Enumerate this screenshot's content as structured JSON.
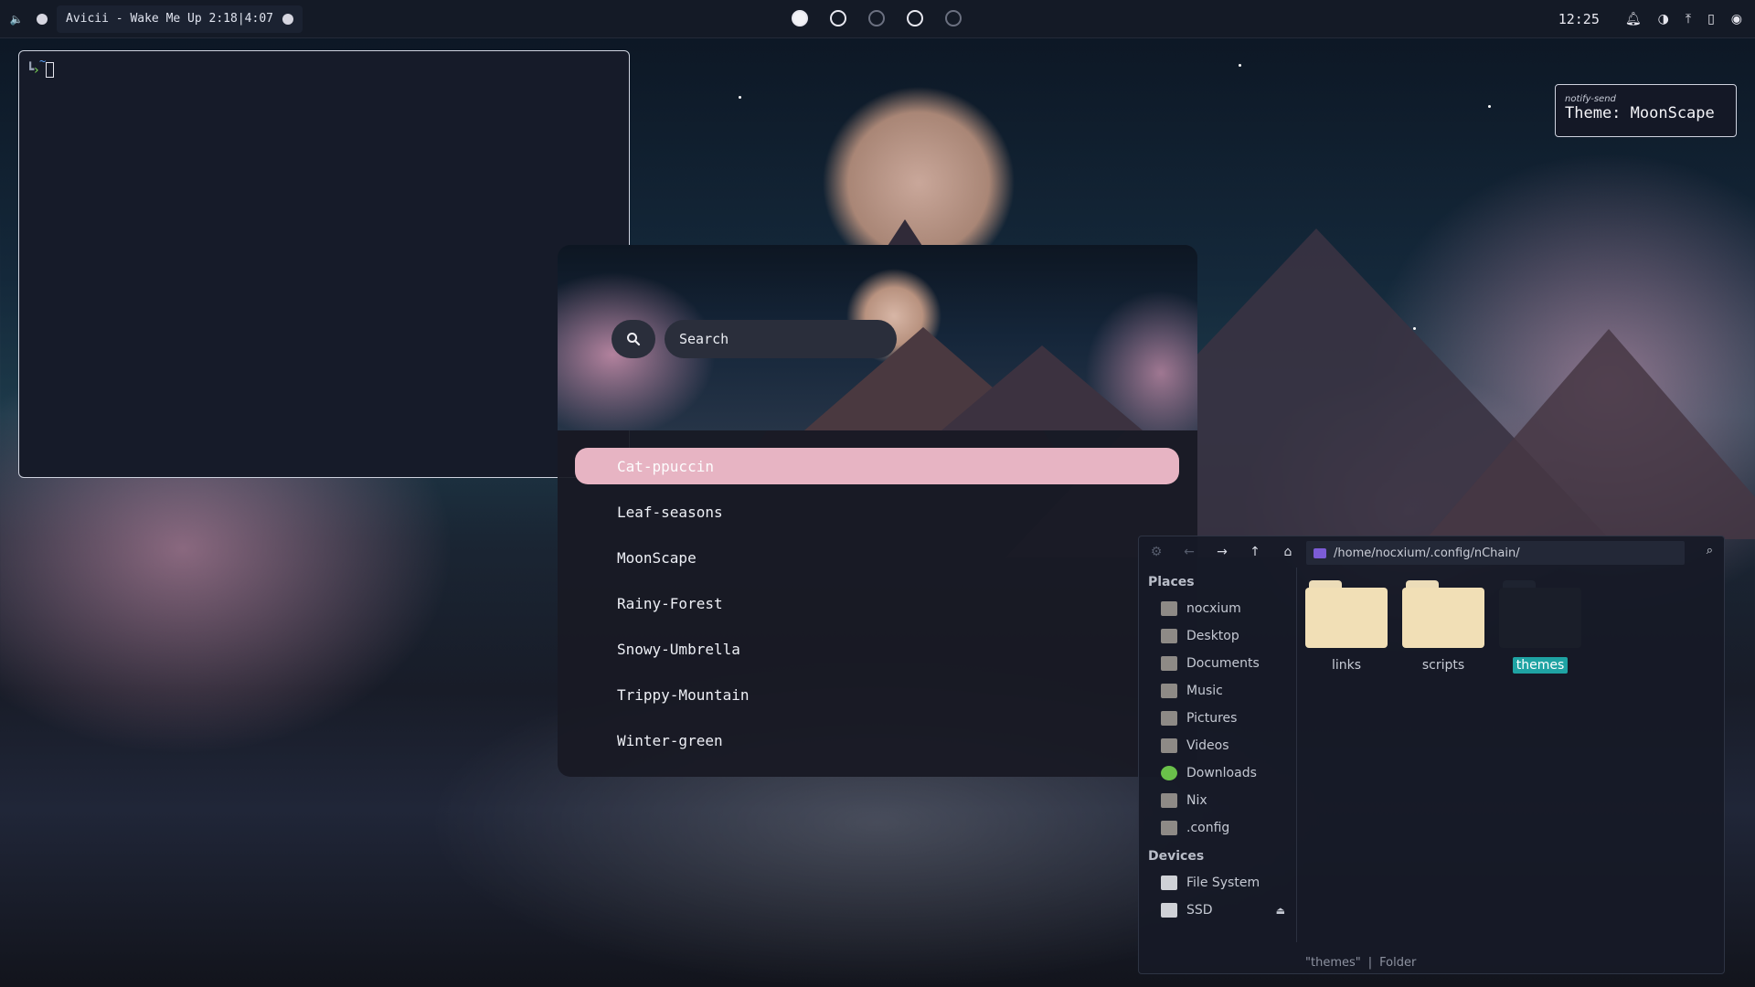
{
  "topbar": {
    "now_playing": "Avicii - Wake Me Up 2:18|4:07",
    "clock": "12:25",
    "workspaces": [
      {
        "state": "active"
      },
      {
        "state": "occupied"
      },
      {
        "state": "empty"
      },
      {
        "state": "occupied"
      },
      {
        "state": "empty"
      }
    ]
  },
  "terminal": {
    "prompt_dir": "~"
  },
  "notification": {
    "app": "notify-send",
    "message": "Theme: MoonScape"
  },
  "launcher": {
    "search_placeholder": "Search",
    "themes": [
      {
        "label": "Cat-ppuccin",
        "selected": true
      },
      {
        "label": "Leaf-seasons",
        "selected": false
      },
      {
        "label": "MoonScape",
        "selected": false
      },
      {
        "label": "Rainy-Forest",
        "selected": false
      },
      {
        "label": "Snowy-Umbrella",
        "selected": false
      },
      {
        "label": "Trippy-Mountain",
        "selected": false
      },
      {
        "label": "Winter-green",
        "selected": false
      }
    ]
  },
  "file_manager": {
    "path": "/home/nocxium/.config/nChain/",
    "sidebar": {
      "places_heading": "Places",
      "places": [
        "nocxium",
        "Desktop",
        "Documents",
        "Music",
        "Pictures",
        "Videos",
        "Downloads",
        "Nix",
        ".config"
      ],
      "devices_heading": "Devices",
      "devices": [
        "File System",
        "SSD"
      ]
    },
    "files": [
      {
        "name": "links",
        "selected": false
      },
      {
        "name": "scripts",
        "selected": false
      },
      {
        "name": "themes",
        "selected": true
      }
    ],
    "status": {
      "name": "\"themes\"",
      "separator": "|",
      "type": "Folder"
    }
  }
}
